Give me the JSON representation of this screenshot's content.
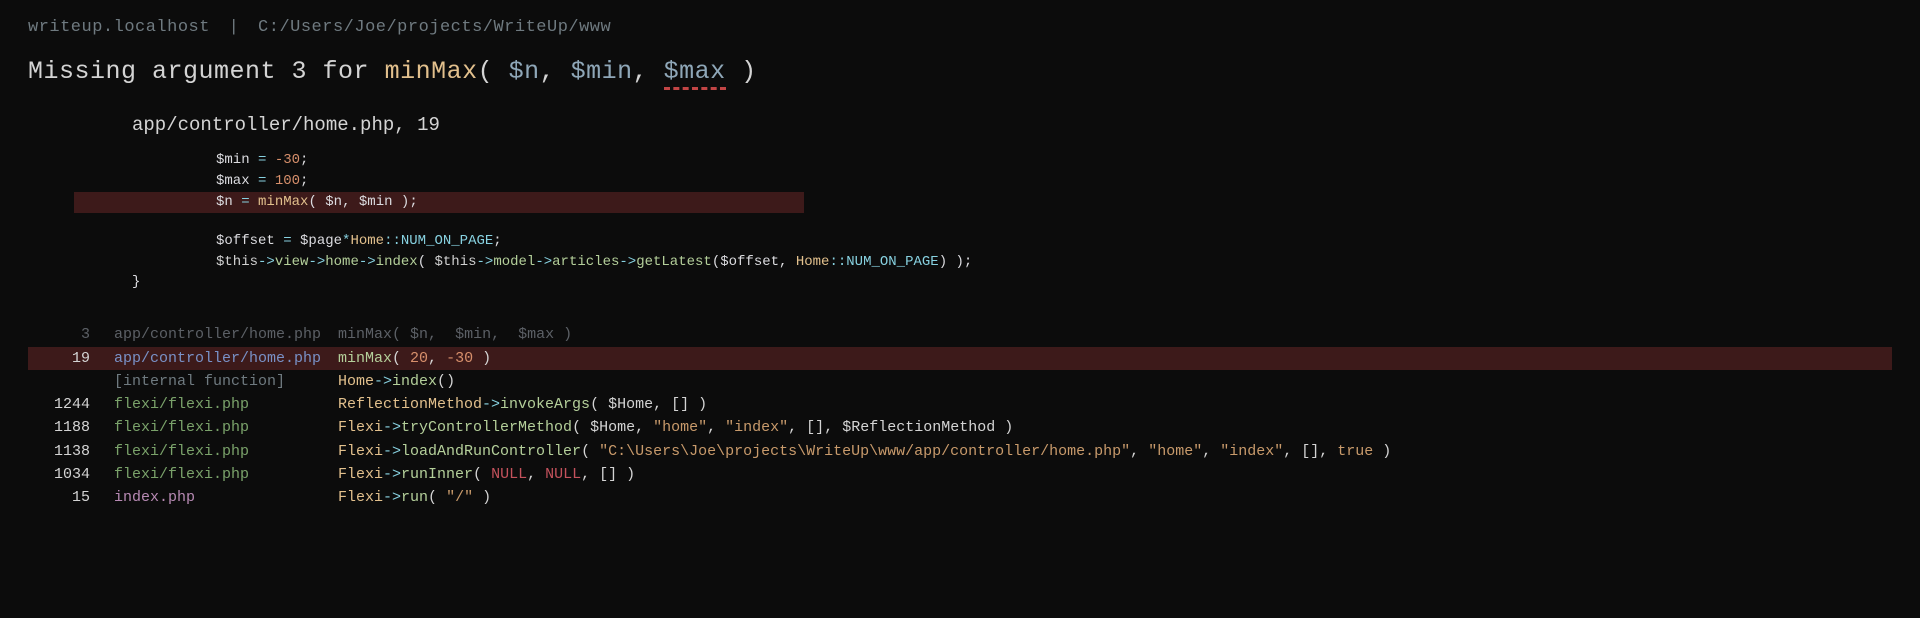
{
  "breadcrumb": {
    "host": "writeup.localhost",
    "sep": "|",
    "path": "C:/Users/Joe/projects/WriteUp/www"
  },
  "title": {
    "prefix": "Missing argument 3 for ",
    "fn": "minMax",
    "open": "( ",
    "args": [
      "$n",
      "$min",
      "$max"
    ],
    "comma": ", ",
    "close": " )",
    "missing_index": 2
  },
  "file_head": {
    "path": "app/controller/home.php",
    "sep": ", ",
    "line": "19"
  },
  "snippet": [
    {
      "t": "assign",
      "var": "$min",
      "op": " = ",
      "num": "-30",
      "end": ";"
    },
    {
      "t": "assign",
      "var": "$max",
      "op": " = ",
      "num": "100",
      "end": ";"
    },
    {
      "t": "call-assign",
      "hl": true,
      "var": "$n",
      "op": " = ",
      "fn": "minMax",
      "open": "( ",
      "args": [
        "$n",
        "$min"
      ],
      "close": " )",
      "end": ";"
    },
    {
      "t": "blank"
    },
    {
      "t": "offset",
      "var": "$offset",
      "op": " = ",
      "rhs_var": "$page",
      "star": "*",
      "cls": "Home",
      "scope": "::",
      "const": "NUM_ON_PAGE",
      "end": ";"
    },
    {
      "t": "chain",
      "this": "$this",
      "arrow": "->",
      "p1": "view",
      "p2": "home",
      "m1": "index",
      "open1": "( ",
      "this2": "$this",
      "p3": "model",
      "p4": "articles",
      "m2": "getLatest",
      "open2": "(",
      "arg1": "$offset",
      "comma": ", ",
      "cls": "Home",
      "scope": "::",
      "const": "NUM_ON_PAGE",
      "close2": ")",
      "close1": " )",
      "end": ";"
    },
    {
      "t": "brace",
      "text": "}"
    }
  ],
  "stack": [
    {
      "dim": true,
      "line": "3",
      "file": "app/controller/home.php",
      "call": {
        "fn": "minMax",
        "args": [
          {
            "k": "v",
            "v": "$n"
          },
          {
            "k": "v",
            "v": "$min"
          },
          {
            "k": "v",
            "v": "$max"
          }
        ]
      }
    },
    {
      "sel": true,
      "line": "19",
      "file": "app/controller/home.php",
      "call": {
        "fn": "minMax",
        "args": [
          {
            "k": "n",
            "v": "20"
          },
          {
            "k": "n",
            "v": "-30"
          }
        ]
      }
    },
    {
      "line": "",
      "file": "[internal function]",
      "call": {
        "cls": "Home",
        "meth": "index",
        "args": []
      }
    },
    {
      "line": "1244",
      "file": "flexi/flexi.php",
      "call": {
        "cls": "ReflectionMethod",
        "meth": "invokeArgs",
        "args": [
          {
            "k": "v",
            "v": "$Home"
          },
          {
            "k": "v",
            "v": "[]"
          }
        ]
      }
    },
    {
      "line": "1188",
      "file": "flexi/flexi.php",
      "call": {
        "cls": "Flexi",
        "meth": "tryControllerMethod",
        "args": [
          {
            "k": "v",
            "v": "$Home"
          },
          {
            "k": "s",
            "v": "\"home\""
          },
          {
            "k": "s",
            "v": "\"index\""
          },
          {
            "k": "v",
            "v": "[]"
          },
          {
            "k": "v",
            "v": "$ReflectionMethod"
          }
        ]
      }
    },
    {
      "line": "1138",
      "file": "flexi/flexi.php",
      "call": {
        "cls": "Flexi",
        "meth": "loadAndRunController",
        "args": [
          {
            "k": "s",
            "v": "\"C:\\Users\\Joe\\projects\\WriteUp\\www/app/controller/home.php\""
          },
          {
            "k": "s",
            "v": "\"home\""
          },
          {
            "k": "s",
            "v": "\"index\""
          },
          {
            "k": "v",
            "v": "[]"
          },
          {
            "k": "t",
            "v": "true"
          }
        ]
      }
    },
    {
      "line": "1034",
      "file": "flexi/flexi.php",
      "call": {
        "cls": "Flexi",
        "meth": "runInner",
        "args": [
          {
            "k": "k",
            "v": "NULL"
          },
          {
            "k": "k",
            "v": "NULL"
          },
          {
            "k": "v",
            "v": "[]"
          }
        ]
      }
    },
    {
      "line": "15",
      "file": "index.php",
      "call": {
        "cls": "Flexi",
        "meth": "run",
        "args": [
          {
            "k": "s",
            "v": "\"/\""
          }
        ]
      }
    }
  ]
}
